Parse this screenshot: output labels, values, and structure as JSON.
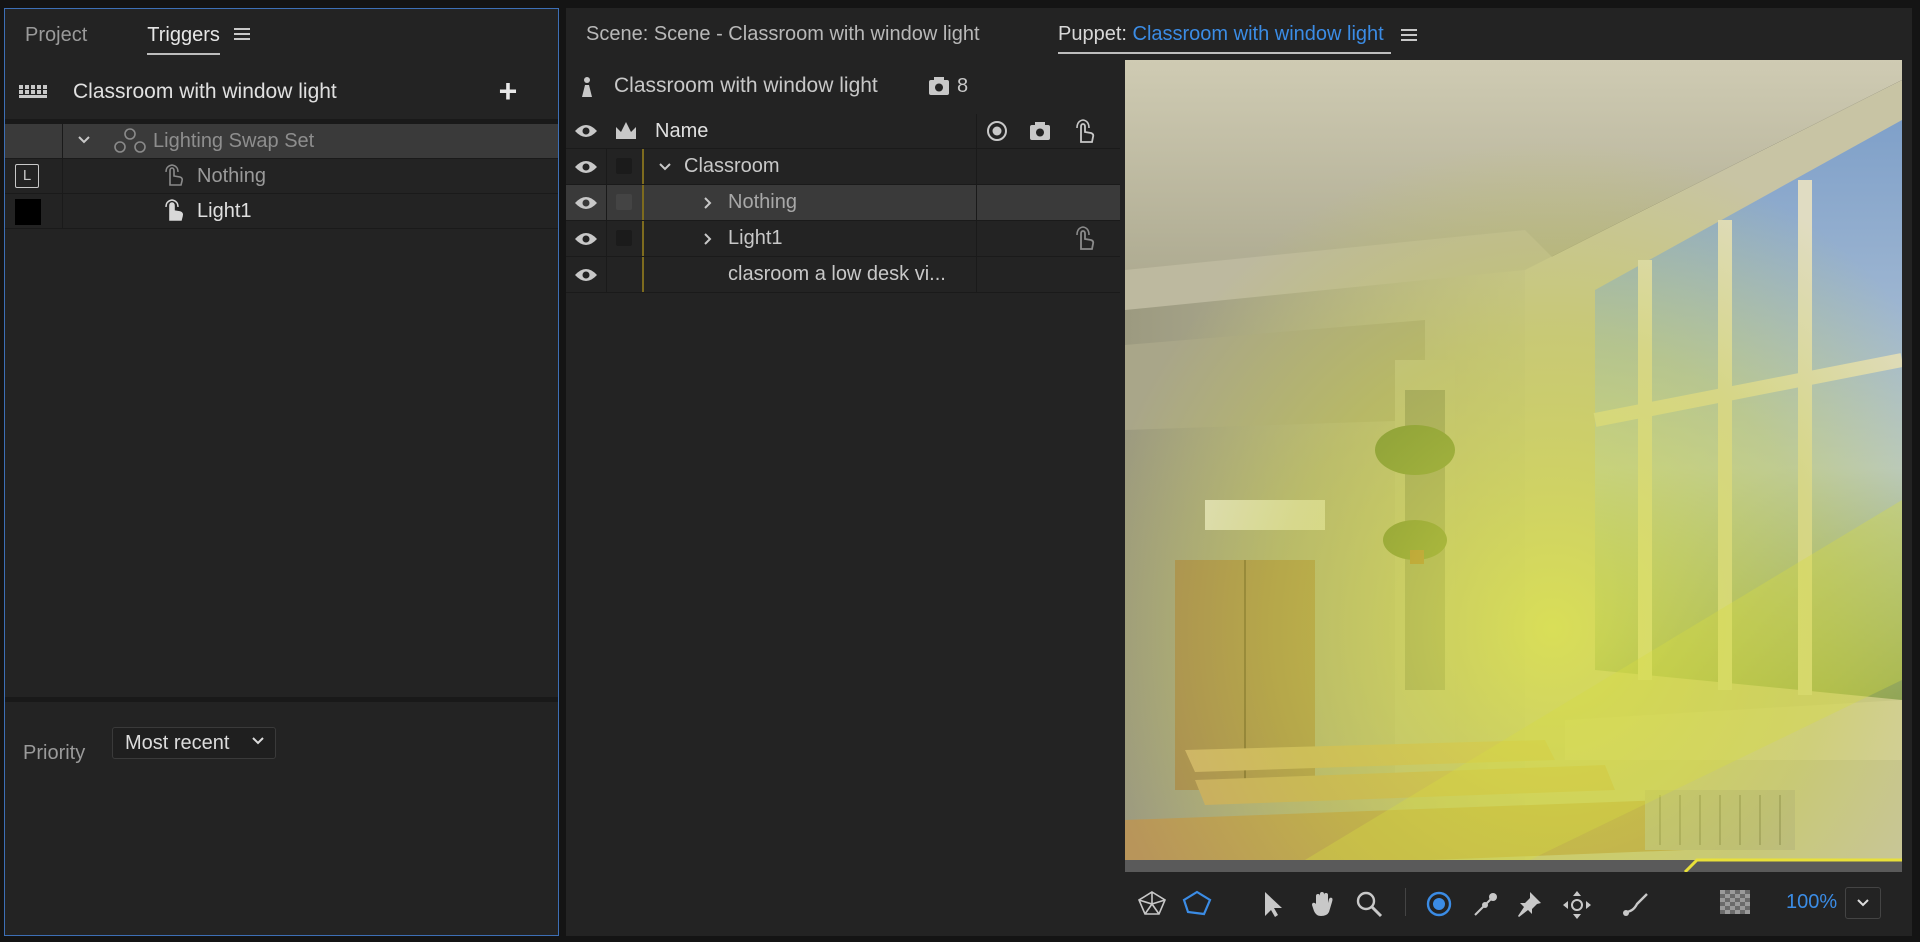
{
  "left": {
    "tabs": {
      "project": "Project",
      "triggers": "Triggers"
    },
    "header_title": "Classroom with window light",
    "tree": {
      "set_label": "Lighting Swap Set",
      "item1_label": "Nothing",
      "item1_key": "L",
      "item2_label": "Light1"
    },
    "priority_label": "Priority",
    "priority_value": "Most recent"
  },
  "right": {
    "scene_tab": "Scene: Scene - Classroom with window light",
    "puppet_tab_prefix": "Puppet:",
    "puppet_tab_name": "Classroom with window light",
    "puppet_name": "Classroom with window light",
    "puppet_count": "8",
    "name_header": "Name",
    "layers": {
      "l0": "Classroom",
      "l1": "Nothing",
      "l2": "Light1",
      "l3": "clasroom a low desk vi..."
    },
    "zoom": "100%"
  },
  "colors": {
    "accent": "#3b8ce5",
    "selection": "#3a3a3a",
    "panel": "#232323"
  }
}
